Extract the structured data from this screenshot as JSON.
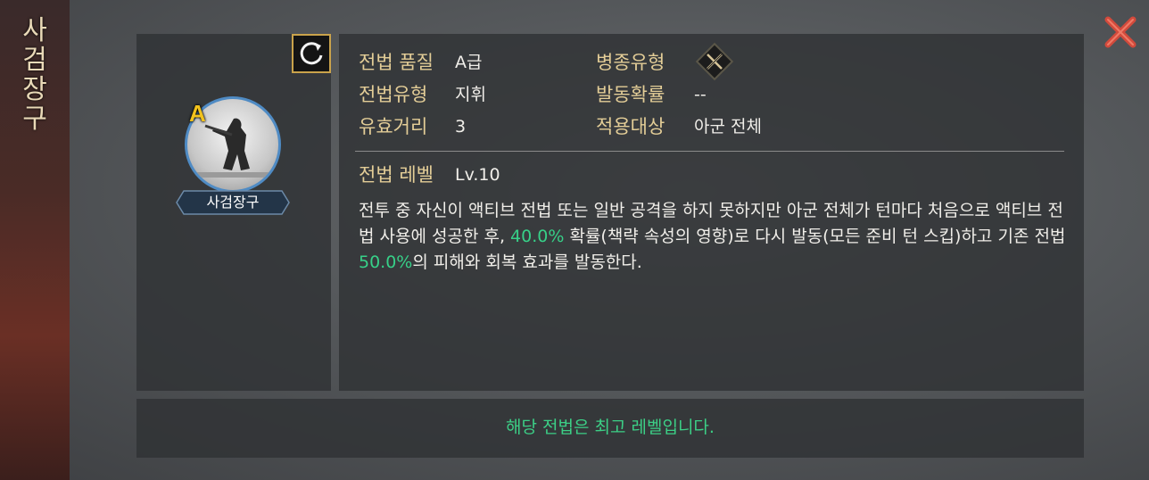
{
  "side_title": "사검장구",
  "tactic": {
    "grade": "A",
    "name": "사검장구"
  },
  "info": {
    "quality_label": "전법 품질",
    "quality_value": "A급",
    "type_label": "전법유형",
    "type_value": "지휘",
    "range_label": "유효거리",
    "range_value": "3",
    "unit_type_label": "병종유형",
    "unit_type_icon": "crossed-swords-icon",
    "chance_label": "발동확률",
    "chance_value": "--",
    "target_label": "적용대상",
    "target_value": "아군 전체",
    "level_label": "전법 레벨",
    "level_value": "Lv.10"
  },
  "description": {
    "part1": "전투 중 자신이 액티브 전법 또는 일반 공격을 하지 못하지만 아군 전체가 턴마다 처음으로 액티브 전법 사용에 성공한 후, ",
    "pct1": "40.0%",
    "part2": " 확률(책략 속성의 영향)로 다시 발동(모든 준비 턴 스킵)하고 기존 전법 ",
    "pct2": "50.0%",
    "part3": "의 피해와 회복 효과를 발동한다."
  },
  "bottom_message": "해당 전법은 최고 레벨입니다.",
  "colors": {
    "label": "#e3cd97",
    "highlight": "#37d088",
    "close": "#d24a3c",
    "portrait_ring": "#4f8bc4",
    "grade": "#f2c21c"
  }
}
